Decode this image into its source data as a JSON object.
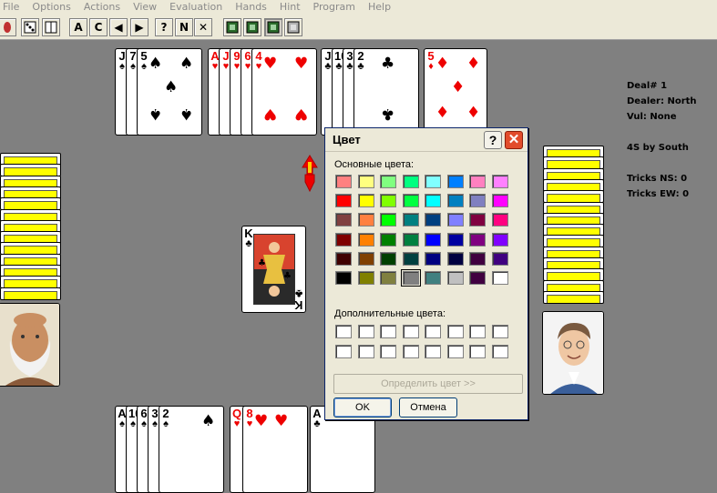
{
  "menu": [
    "File",
    "Options",
    "Actions",
    "View",
    "Evaluation",
    "Hands",
    "Hint",
    "Program",
    "Help"
  ],
  "toolbar": {
    "icons": [
      "stop-icon",
      "dice-icon",
      "grid-icon",
      "a-icon",
      "c-icon",
      "back-icon",
      "forward-icon",
      "question-icon",
      "n-icon",
      "x-icon",
      "film1-icon",
      "film2-icon",
      "film3-icon",
      "film4-icon"
    ],
    "labels": [
      "",
      "",
      "",
      "A",
      "C",
      "◀",
      "▶",
      "?",
      "N",
      "✕",
      "",
      "",
      "",
      ""
    ]
  },
  "north_hand": {
    "hearts": [
      {
        "rank": "J",
        "suit": "♠"
      },
      {
        "rank": "7",
        "suit": "♠"
      },
      {
        "rank": "5",
        "suit": "♠"
      }
    ]
  },
  "hands": {
    "north": [
      {
        "label": "J",
        "suit": "♠",
        "color": "blk"
      },
      {
        "label": "7",
        "suit": "♠",
        "color": "blk"
      },
      {
        "label": "5",
        "suit": "♠",
        "color": "blk"
      },
      {
        "label": "A",
        "suit": "♥",
        "color": "red"
      },
      {
        "label": "J",
        "suit": "♥",
        "color": "red"
      },
      {
        "label": "9",
        "suit": "♥",
        "color": "red"
      },
      {
        "label": "6",
        "suit": "♥",
        "color": "red"
      },
      {
        "label": "4",
        "suit": "♥",
        "color": "red"
      },
      {
        "label": "J",
        "suit": "♣",
        "color": "blk"
      },
      {
        "label": "10",
        "suit": "♣",
        "color": "blk"
      },
      {
        "label": "3",
        "suit": "♣",
        "color": "blk"
      },
      {
        "label": "2",
        "suit": "♣",
        "color": "blk"
      },
      {
        "label": "5",
        "suit": "♦",
        "color": "red"
      }
    ],
    "south": [
      {
        "label": "A",
        "suit": "♠",
        "color": "blk"
      },
      {
        "label": "10",
        "suit": "♠",
        "color": "blk"
      },
      {
        "label": "6",
        "suit": "♠",
        "color": "blk"
      },
      {
        "label": "3",
        "suit": "♠",
        "color": "blk"
      },
      {
        "label": "2",
        "suit": "♠",
        "color": "blk"
      },
      {
        "label": "Q",
        "suit": "♥",
        "color": "red"
      },
      {
        "label": "8",
        "suit": "♥",
        "color": "red"
      },
      {
        "label": "A",
        "suit": "♣",
        "color": "blk"
      }
    ]
  },
  "trick_card": {
    "rank": "K",
    "suit": "♣"
  },
  "info": {
    "deal": "Deal# 1",
    "dealer": "Dealer: North",
    "vul": "Vul: None",
    "contract": "4S by South",
    "tricks_ns": "Tricks NS: 0",
    "tricks_ew": "Tricks EW: 0"
  },
  "dialog": {
    "title": "Цвет",
    "help": "?",
    "close": "✕",
    "basic_label": "Основные цвета:",
    "custom_label": "Дополнительные цвета:",
    "define_button": "Определить цвет >>",
    "ok": "OK",
    "cancel": "Отмена",
    "basic_colors": [
      "#ff8080",
      "#ffff80",
      "#80ff80",
      "#00ff80",
      "#80ffff",
      "#0080ff",
      "#ff80c0",
      "#ff80ff",
      "#ff0000",
      "#ffff00",
      "#80ff00",
      "#00ff40",
      "#00ffff",
      "#0080c0",
      "#8080c0",
      "#ff00ff",
      "#804040",
      "#ff8040",
      "#00ff00",
      "#008080",
      "#004080",
      "#8080ff",
      "#800040",
      "#ff0080",
      "#800000",
      "#ff8000",
      "#008000",
      "#008040",
      "#0000ff",
      "#0000a0",
      "#800080",
      "#8000ff",
      "#400000",
      "#804000",
      "#004000",
      "#004040",
      "#000080",
      "#000040",
      "#400040",
      "#400080",
      "#000000",
      "#808000",
      "#808040",
      "#808080",
      "#408080",
      "#c0c0c0",
      "#400040",
      "#ffffff"
    ],
    "selected_index": 43
  }
}
